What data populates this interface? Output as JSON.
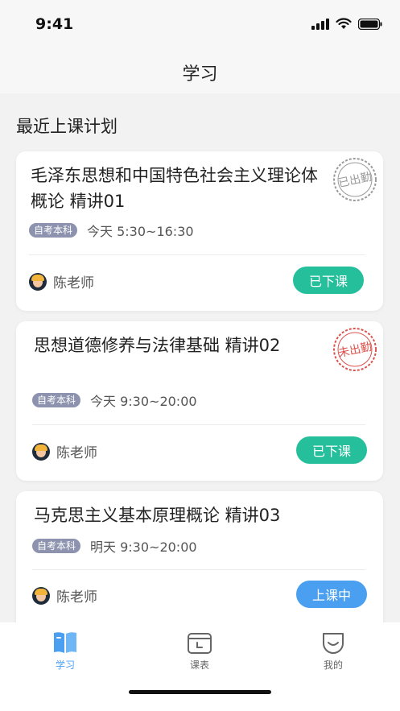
{
  "status_bar": {
    "time": "9:41"
  },
  "nav": {
    "title": "学习"
  },
  "section": {
    "title": "最近上课计划"
  },
  "cards": [
    {
      "title": "毛泽东思想和中国特色社会主义理论体概论 精讲01",
      "tag": "自考本科",
      "time": "今天 5:30~16:30",
      "teacher": "陈老师",
      "status": "已下课",
      "status_color": "#25c09b",
      "stamp": "已出勤",
      "stamp_color": "#9a9a9a"
    },
    {
      "title": "思想道德修养与法律基础 精讲02",
      "tag": "自考本科",
      "time": "今天 9:30~20:00",
      "teacher": "陈老师",
      "status": "已下课",
      "status_color": "#25c09b",
      "stamp": "未出勤",
      "stamp_color": "#d9534f"
    },
    {
      "title": "马克思主义基本原理概论 精讲03",
      "tag": "自考本科",
      "time": "明天 9:30~20:00",
      "teacher": "陈老师",
      "status": "上课中",
      "status_color": "#4a9ff0"
    }
  ],
  "tabs": [
    {
      "label": "学习",
      "icon": "book-icon",
      "active": true
    },
    {
      "label": "课表",
      "icon": "calendar-icon",
      "active": false
    },
    {
      "label": "我的",
      "icon": "smile-face-icon",
      "active": false
    }
  ],
  "colors": {
    "accent": "#4a9ff0",
    "tab_inactive": "#666666",
    "success": "#25c09b",
    "absent": "#d9534f"
  }
}
